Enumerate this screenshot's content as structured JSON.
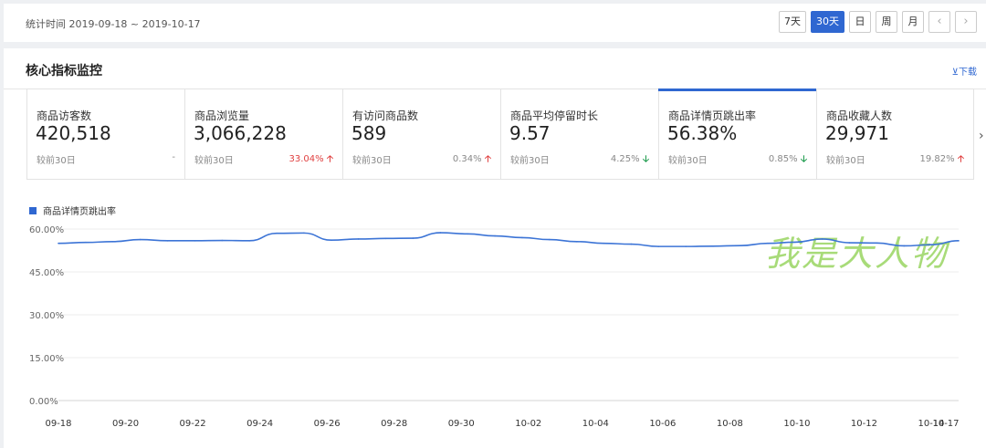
{
  "header": {
    "period_text": "统计时间 2019-09-18 ~ 2019-10-17",
    "range_buttons": [
      "7天",
      "30天",
      "日",
      "周",
      "月"
    ],
    "active_range": "30天",
    "prev_icon": "chevron-left-icon",
    "next_icon": "chevron-right-icon"
  },
  "panel": {
    "title": "核心指标监控",
    "download_label": "⊻下载"
  },
  "cards": [
    {
      "label": "商品访客数",
      "value": "420,518",
      "compare_label": "较前30日",
      "change": "-",
      "direction": "none"
    },
    {
      "label": "商品浏览量",
      "value": "3,066,228",
      "compare_label": "较前30日",
      "change": "33.04%",
      "direction": "up"
    },
    {
      "label": "有访问商品数",
      "value": "589",
      "compare_label": "较前30日",
      "change": "0.34%",
      "direction": "up"
    },
    {
      "label": "商品平均停留时长",
      "value": "9.57",
      "compare_label": "较前30日",
      "change": "4.25%",
      "direction": "down"
    },
    {
      "label": "商品详情页跳出率",
      "value": "56.38%",
      "compare_label": "较前30日",
      "change": "0.85%",
      "direction": "down",
      "selected": true
    },
    {
      "label": "商品收藏人数",
      "value": "29,971",
      "compare_label": "较前30日",
      "change": "19.82%",
      "direction": "up"
    }
  ],
  "colors": {
    "accent": "#2f67d1",
    "up": "#e04040",
    "down": "#1a9a4a",
    "line": "#3c74d6"
  },
  "watermark_text": "我是大人物",
  "chart_data": {
    "type": "line",
    "series": [
      {
        "name": "商品详情页跳出率",
        "values": [
          55.0,
          55.3,
          55.6,
          56.3,
          55.9,
          55.9,
          56.0,
          55.9,
          58.5,
          58.6,
          56.1,
          56.5,
          56.7,
          56.8,
          58.7,
          58.3,
          57.6,
          57.0,
          56.3,
          55.6,
          55.0,
          54.7,
          53.9,
          53.9,
          54.0,
          54.2,
          55.0,
          55.4,
          56.5,
          55.2,
          55.1,
          54.1,
          54.5,
          55.9
        ]
      }
    ],
    "x_labels": [
      "09-18",
      "09-20",
      "09-22",
      "09-24",
      "09-26",
      "09-28",
      "09-30",
      "10-02",
      "10-04",
      "10-06",
      "10-08",
      "10-10",
      "10-12",
      "10-14",
      "10-17"
    ],
    "y_ticks": [
      "60.00%",
      "45.00%",
      "30.00%",
      "15.00%",
      "0.00%"
    ],
    "ylim": [
      0,
      60
    ],
    "grid": true,
    "legend_position": "top-left"
  }
}
